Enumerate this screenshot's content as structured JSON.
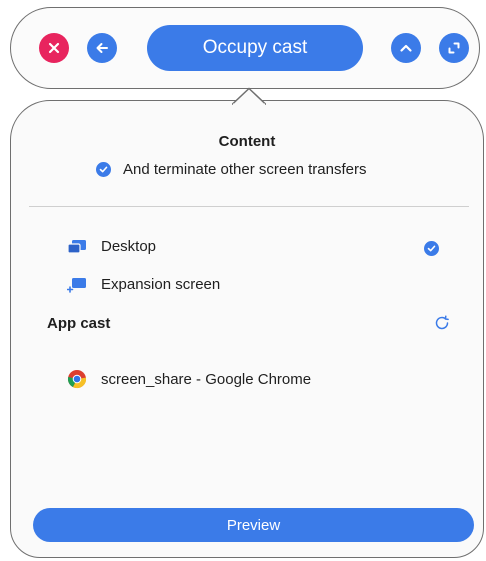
{
  "toolbar": {
    "primary_label": "Occupy cast"
  },
  "panel": {
    "content_title": "Content",
    "terminate_label": "And terminate other screen transfers",
    "sources": [
      {
        "label": "Desktop",
        "selected": true,
        "icon": "desktop-icon"
      },
      {
        "label": "Expansion screen",
        "selected": false,
        "icon": "expansion-screen-icon"
      }
    ],
    "app_cast_title": "App cast",
    "apps": [
      {
        "label": "screen_share - Google Chrome",
        "icon": "chrome-icon"
      }
    ],
    "preview_label": "Preview"
  },
  "colors": {
    "accent": "#3b7be8",
    "close": "#e8245e"
  }
}
